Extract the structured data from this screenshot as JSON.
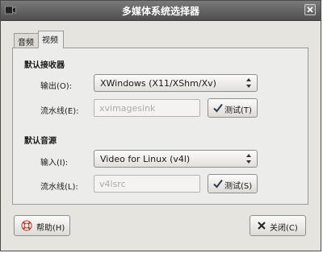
{
  "window": {
    "title": "多媒体系统选择器"
  },
  "tabs": [
    {
      "label": "音频",
      "active": false
    },
    {
      "label": "视频",
      "active": true
    }
  ],
  "video_output": {
    "section_title": "默认接收器",
    "output_label": "输出(O):",
    "output_value": "XWindows (X11/XShm/Xv)",
    "pipeline_label": "流水线(E):",
    "pipeline_value": "xvimagesink",
    "test_button": "测试(T)"
  },
  "video_input": {
    "section_title": "默认音源",
    "input_label": "输入(I):",
    "input_value": "Video for Linux (v4l)",
    "pipeline_label": "流水线(L):",
    "pipeline_value": "v4lsrc",
    "test_button": "测试(S)"
  },
  "footer": {
    "help_button": "帮助(H)",
    "close_button": "关闭(C)"
  },
  "icons": {
    "app": "camera-icon",
    "close_window": "close-icon",
    "test": "checkmark-icon",
    "help": "lifebuoy-icon",
    "close": "x-icon"
  }
}
